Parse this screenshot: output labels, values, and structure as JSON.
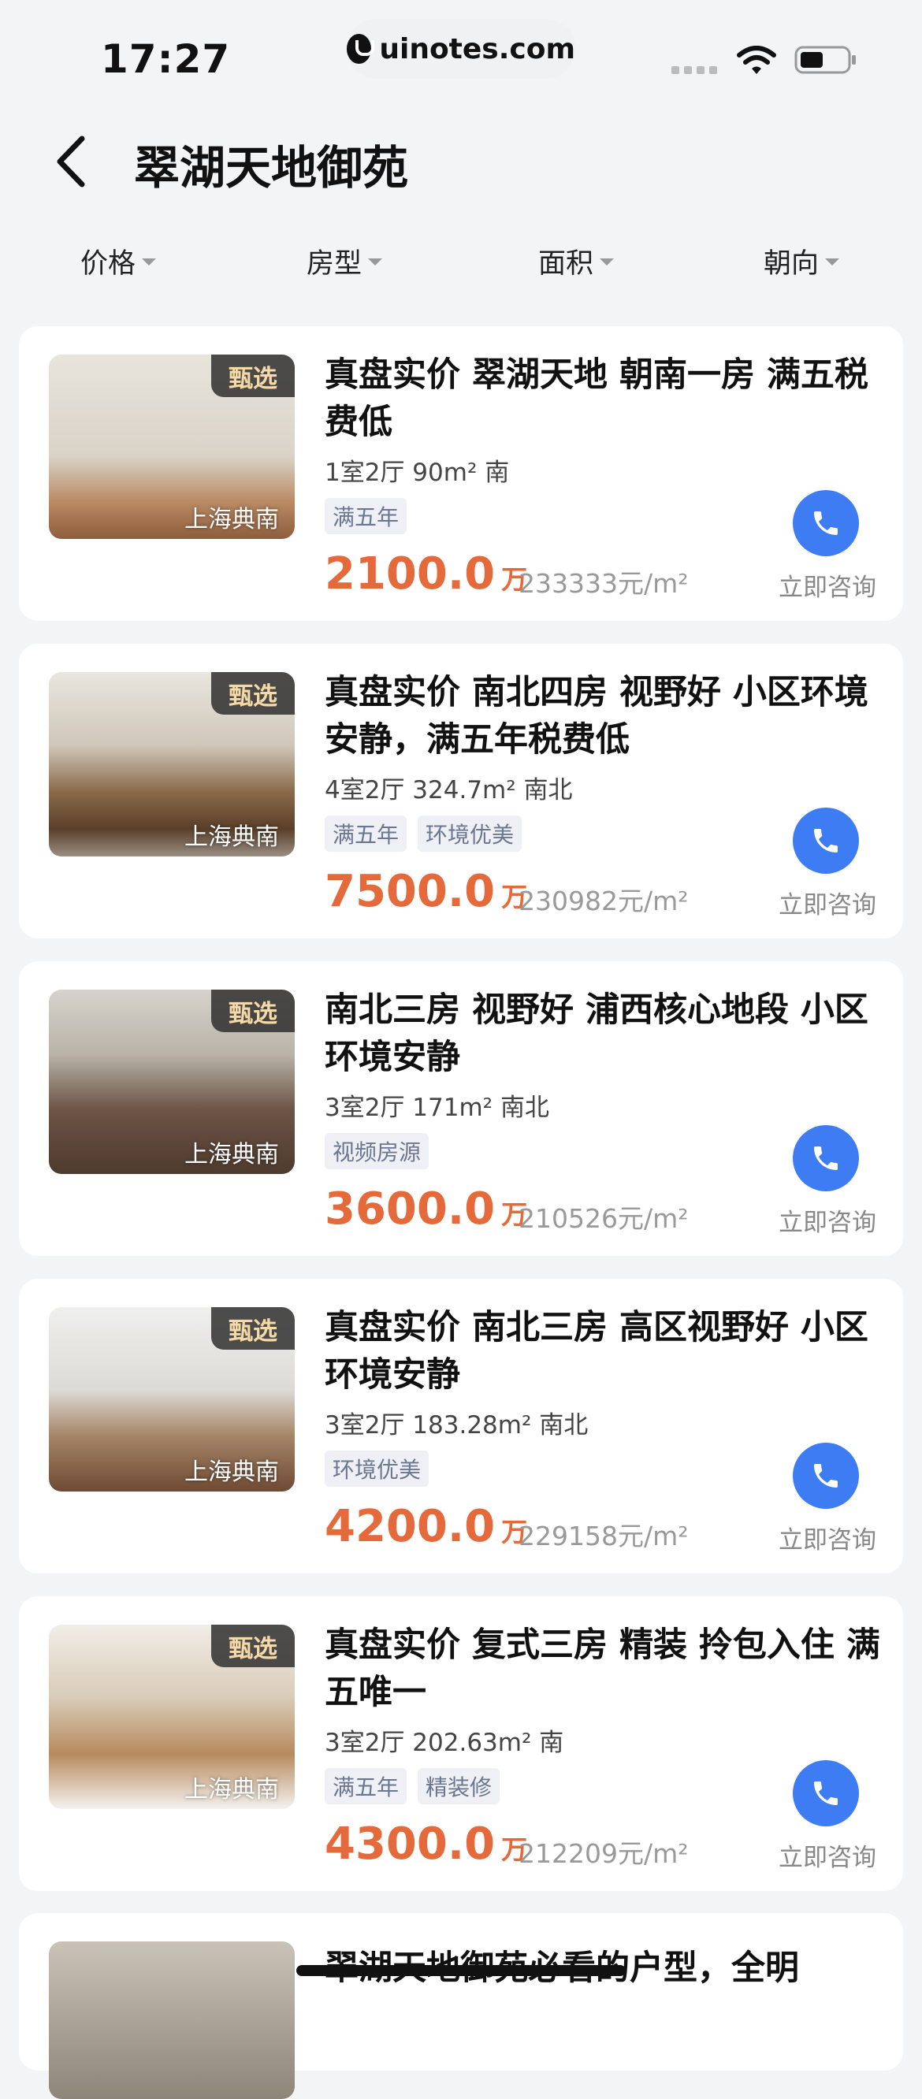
{
  "status_bar": {
    "time": "17:27",
    "url": "uinotes.com"
  },
  "nav": {
    "title": "翠湖天地御苑"
  },
  "filters": [
    "价格",
    "房型",
    "面积",
    "朝向"
  ],
  "listings": [
    {
      "badge": "甄选",
      "watermark": "上海典南",
      "title": "真盘实价  翠湖天地 朝南一房 满五税费低",
      "info": "1室2厅  90m²  南",
      "tags": [
        "满五年"
      ],
      "price": "2100.0",
      "price_unit": "万",
      "unit_price": "233333元/m²",
      "call_label": "立即咨询"
    },
    {
      "badge": "甄选",
      "watermark": "上海典南",
      "title": "真盘实价 南北四房  视野好 小区环境安静，满五年税费低",
      "info": "4室2厅  324.7m²  南北",
      "tags": [
        "满五年",
        "环境优美"
      ],
      "price": "7500.0",
      "price_unit": "万",
      "unit_price": "230982元/m²",
      "call_label": "立即咨询"
    },
    {
      "badge": "甄选",
      "watermark": "上海典南",
      "title": "南北三房  视野好 浦西核心地段 小区环境安静",
      "info": "3室2厅  171m²  南北",
      "tags": [
        "视频房源"
      ],
      "price": "3600.0",
      "price_unit": "万",
      "unit_price": "210526元/m²",
      "call_label": "立即咨询"
    },
    {
      "badge": "甄选",
      "watermark": "上海典南",
      "title": "真盘实价 南北三房  高区视野好 小区环境安静",
      "info": "3室2厅  183.28m²  南北",
      "tags": [
        "环境优美"
      ],
      "price": "4200.0",
      "price_unit": "万",
      "unit_price": "229158元/m²",
      "call_label": "立即咨询"
    },
    {
      "badge": "甄选",
      "watermark": "上海典南",
      "title": "真盘实价 复式三房 精装 拎包入住 满五唯一",
      "info": "3室2厅  202.63m²  南",
      "tags": [
        "满五年",
        "精装修"
      ],
      "price": "4300.0",
      "price_unit": "万",
      "unit_price": "212209元/m²",
      "call_label": "立即咨询"
    }
  ],
  "partial_listing": {
    "title": "翠湖天地御苑必看的户型，全明"
  },
  "colors": {
    "price": "#e56a3b",
    "call": "#3d7cf2",
    "badge_text": "#f5d9a6"
  },
  "icons": {
    "back": "chevron-left-icon",
    "call": "phone-icon",
    "filter": "caret-down-icon"
  }
}
